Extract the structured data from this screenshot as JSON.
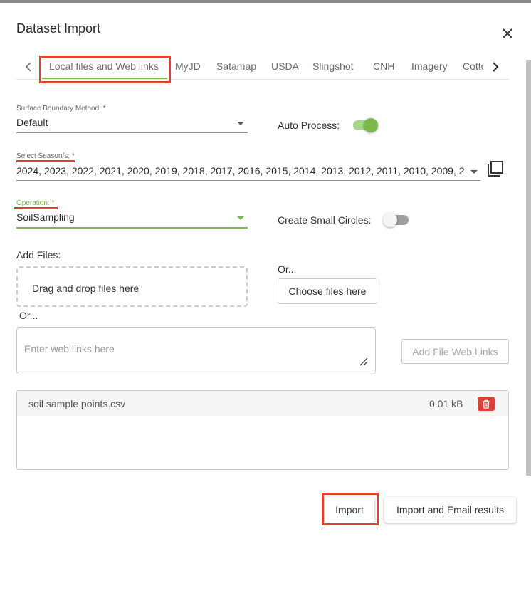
{
  "dialog": {
    "title": "Dataset Import"
  },
  "tabs": {
    "items": [
      "Local files and Web links",
      "MyJD",
      "Satamap",
      "USDA",
      "Slingshot",
      "CNH",
      "Imagery",
      "Cotto"
    ],
    "active": "Local files and Web links"
  },
  "surface": {
    "label": "Surface Boundary Method: *",
    "value": "Default"
  },
  "auto_process": {
    "label": "Auto Process:",
    "on": true
  },
  "season": {
    "label": "Select Season/s: *",
    "value": "2024, 2023, 2022, 2021, 2020, 2019, 2018, 2017, 2016, 2015, 2014, 2013, 2012, 2011, 2010, 2009, 20..."
  },
  "operation": {
    "label": "Operation: *",
    "value": "SoilSampling"
  },
  "small_circles": {
    "label": "Create Small Circles:",
    "on": false
  },
  "files": {
    "label": "Add Files:",
    "drop_text": "Drag and drop files here",
    "or_1": "Or...",
    "choose_button": "Choose files here",
    "or_2": "Or...",
    "weblinks_placeholder": "Enter web links here",
    "add_weblinks_button": "Add File Web Links",
    "list": [
      {
        "name": "soil sample points.csv",
        "size": "0.01 kB"
      }
    ]
  },
  "footer": {
    "import_button": "Import",
    "import_email_button": "Import and Email results"
  },
  "colors": {
    "accent_green": "#7cb84a",
    "annotation_red": "#d9442f",
    "delete_red": "#dc3f3a"
  }
}
